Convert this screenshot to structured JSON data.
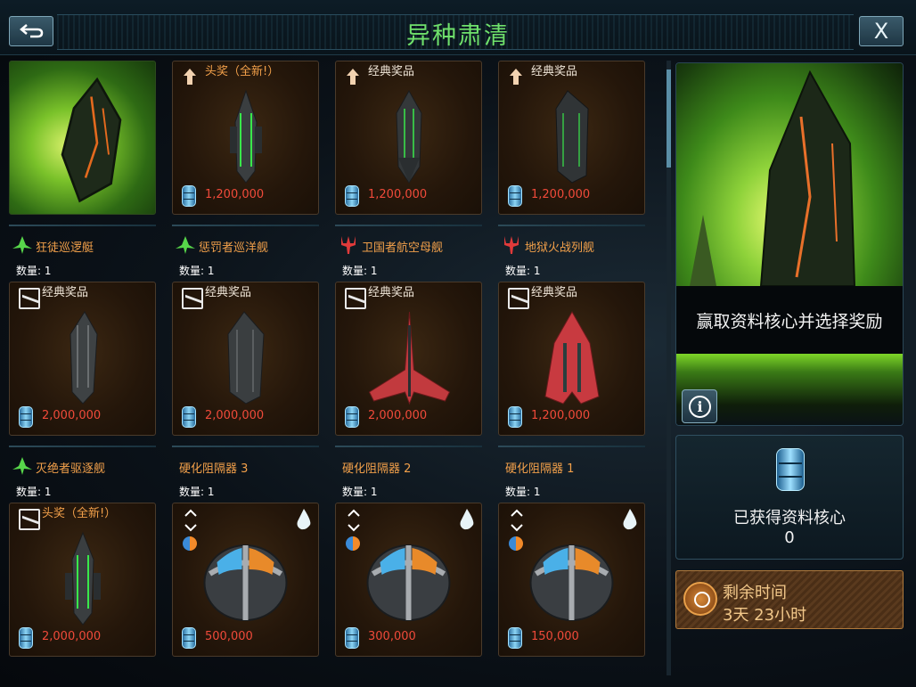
{
  "header": {
    "title": "异种肃清",
    "back_icon": "back-arrow-icon",
    "close_label": "X"
  },
  "rows": [
    {
      "cards": [
        {
          "kind": "art",
          "label": "",
          "price": ""
        },
        {
          "kind": "reward",
          "icon": "up-arrow-icon",
          "label": "头奖（全新!）",
          "price": "1,200,000"
        },
        {
          "kind": "reward",
          "icon": "up-arrow-icon",
          "label": "经典奖品",
          "price": "1,200,000"
        },
        {
          "kind": "reward",
          "icon": "up-arrow-icon",
          "label": "经典奖品",
          "price": "1,200,000"
        }
      ],
      "names": [
        {
          "name": "狂徒巡逻艇",
          "icon": "green-wing-icon",
          "qty": "数量: 1"
        },
        {
          "name": "惩罚者巡洋舰",
          "icon": "green-wing-icon",
          "qty": "数量: 1"
        },
        {
          "name": "卫国者航空母舰",
          "icon": "red-trident-icon",
          "qty": "数量: 1"
        },
        {
          "name": "地狱火战列舰",
          "icon": "red-trident-icon",
          "qty": "数量: 1"
        }
      ]
    },
    {
      "cards": [
        {
          "kind": "reward",
          "icon": "chart-icon",
          "label": "经典奖品",
          "price": "2,000,000"
        },
        {
          "kind": "reward",
          "icon": "chart-icon",
          "label": "经典奖品",
          "price": "2,000,000"
        },
        {
          "kind": "reward",
          "icon": "chart-icon",
          "label": "经典奖品",
          "price": "2,000,000"
        },
        {
          "kind": "reward",
          "icon": "chart-icon",
          "label": "经典奖品",
          "price": "1,200,000"
        }
      ],
      "names": [
        {
          "name": "灭绝者驱逐舰",
          "icon": "green-wing-icon",
          "qty": "数量: 1"
        },
        {
          "name": "硬化阻隔器 3",
          "icon": "",
          "qty": "数量: 1"
        },
        {
          "name": "硬化阻隔器 2",
          "icon": "",
          "qty": "数量: 1"
        },
        {
          "name": "硬化阻隔器 1",
          "icon": "",
          "qty": "数量: 1"
        }
      ]
    },
    {
      "cards": [
        {
          "kind": "reward",
          "icon": "chart-icon",
          "label": "头奖（全新!）",
          "price": "2,000,000"
        },
        {
          "kind": "module",
          "icon": "",
          "label": "",
          "price": "500,000"
        },
        {
          "kind": "module",
          "icon": "",
          "label": "",
          "price": "300,000"
        },
        {
          "kind": "module",
          "icon": "",
          "label": "",
          "price": "150,000"
        }
      ]
    }
  ],
  "side": {
    "prompt": "赢取资料核心并选择奖励",
    "info_icon": "info-icon",
    "cores_label": "已获得资料核心",
    "cores_value": "0",
    "timer_label": "剩余时间",
    "timer_value": "3天 23小时"
  },
  "colors": {
    "title_green": "#6fe06b",
    "price_red": "#f04a3a",
    "name_orange": "#f2a04a"
  }
}
